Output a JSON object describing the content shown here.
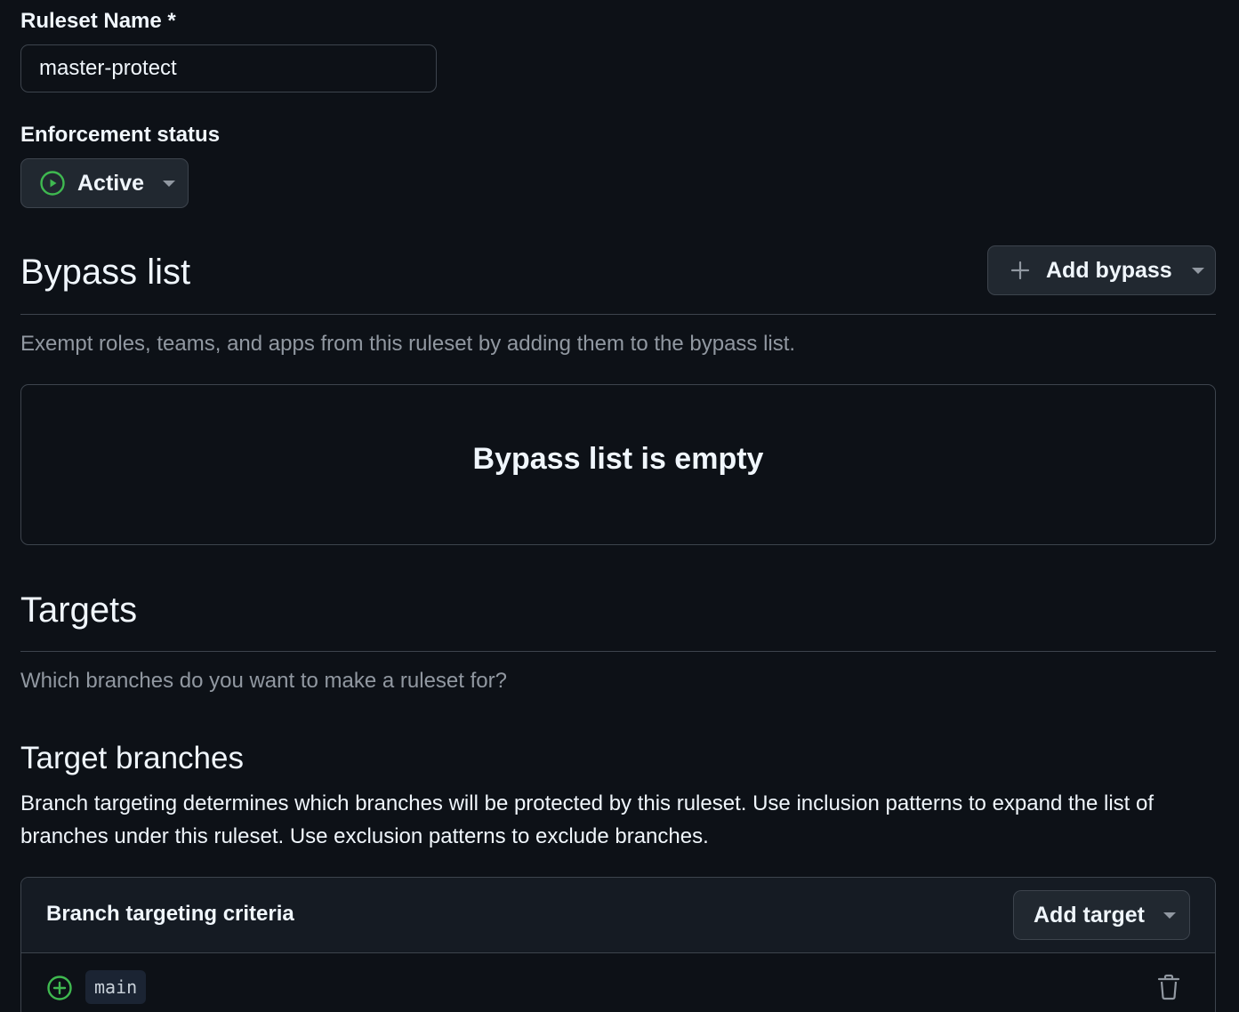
{
  "ruleset_name": {
    "label": "Ruleset Name *",
    "value": "master-protect"
  },
  "enforcement": {
    "label": "Enforcement status",
    "selected": "Active",
    "status_color": "#3fb950"
  },
  "bypass": {
    "title": "Bypass list",
    "add_button_label": "Add bypass",
    "description": "Exempt roles, teams, and apps from this ruleset by adding them to the bypass list.",
    "empty_message": "Bypass list is empty"
  },
  "targets": {
    "title": "Targets",
    "description": "Which branches do you want to make a ruleset for?"
  },
  "target_branches": {
    "title": "Target branches",
    "description": "Branch targeting determines which branches will be protected by this ruleset. Use inclusion patterns to expand the list of branches under this ruleset. Use exclusion patterns to exclude branches.",
    "criteria_title": "Branch targeting criteria",
    "add_target_label": "Add target",
    "items": [
      {
        "pattern": "main",
        "type_icon": "plus-circle-icon",
        "type_color": "#3fb950"
      }
    ]
  },
  "icons": {
    "status": "play-circle-icon",
    "add": "plus-icon",
    "dropdown": "triangle-down-icon",
    "delete": "trash-icon"
  }
}
